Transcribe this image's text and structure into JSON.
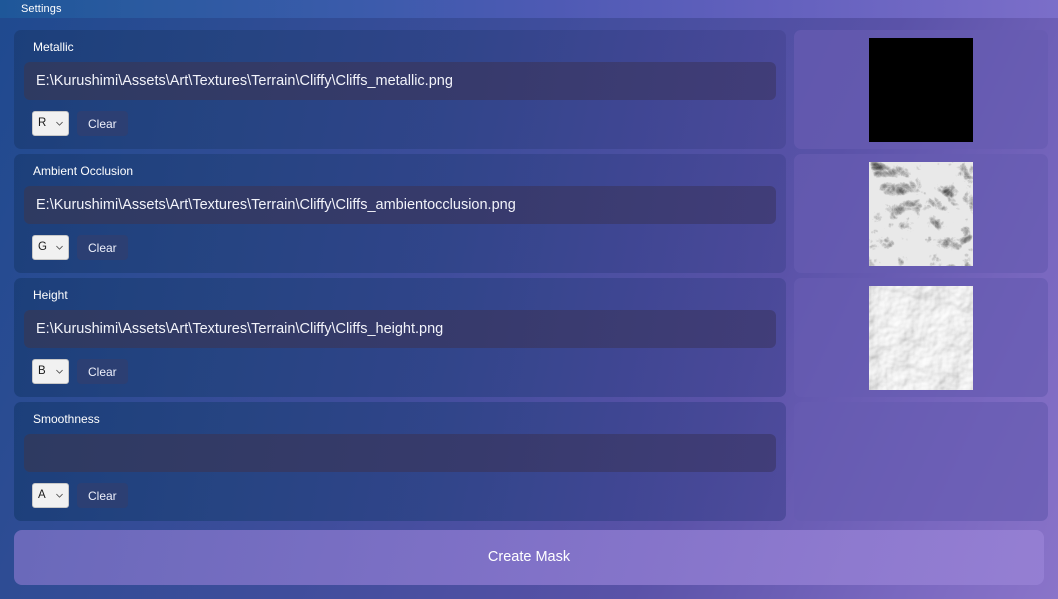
{
  "window": {
    "title": "Settings"
  },
  "theme": {
    "accent": "#6c5cb2",
    "titlebar_start": "#1e5799",
    "titlebar_end": "#7b6ec9",
    "card_bg": "#1c3f7a",
    "field_bg": "#323a68",
    "clear_button_bg": "#2c3f73",
    "select_bg": "#f1f1f1",
    "button_bg": "#8a7ad0"
  },
  "channels": [
    {
      "label": "Metallic",
      "path": "E:\\Kurushimi\\Assets\\Art\\Textures\\Terrain\\Cliffy\\Cliffs_metallic.png",
      "path_placeholder": "",
      "channel": "R",
      "clear_label": "Clear",
      "preview": "solid-black-texture"
    },
    {
      "label": "Ambient Occlusion",
      "path": "E:\\Kurushimi\\Assets\\Art\\Textures\\Terrain\\Cliffy\\Cliffs_ambientocclusion.png",
      "path_placeholder": "",
      "channel": "G",
      "clear_label": "Clear",
      "preview": "rocky-grayscale-texture"
    },
    {
      "label": "Height",
      "path": "E:\\Kurushimi\\Assets\\Art\\Textures\\Terrain\\Cliffy\\Cliffs_height.png",
      "path_placeholder": "",
      "channel": "B",
      "clear_label": "Clear",
      "preview": "cloudy-heightmap-texture"
    },
    {
      "label": "Smoothness",
      "path": "",
      "path_placeholder": "",
      "channel": "A",
      "clear_label": "Clear",
      "preview": "empty"
    }
  ],
  "channel_options": [
    "R",
    "G",
    "B",
    "A"
  ],
  "actions": {
    "create_mask_label": "Create Mask"
  },
  "icons": {
    "chevron_down": "chevron-down-icon"
  }
}
